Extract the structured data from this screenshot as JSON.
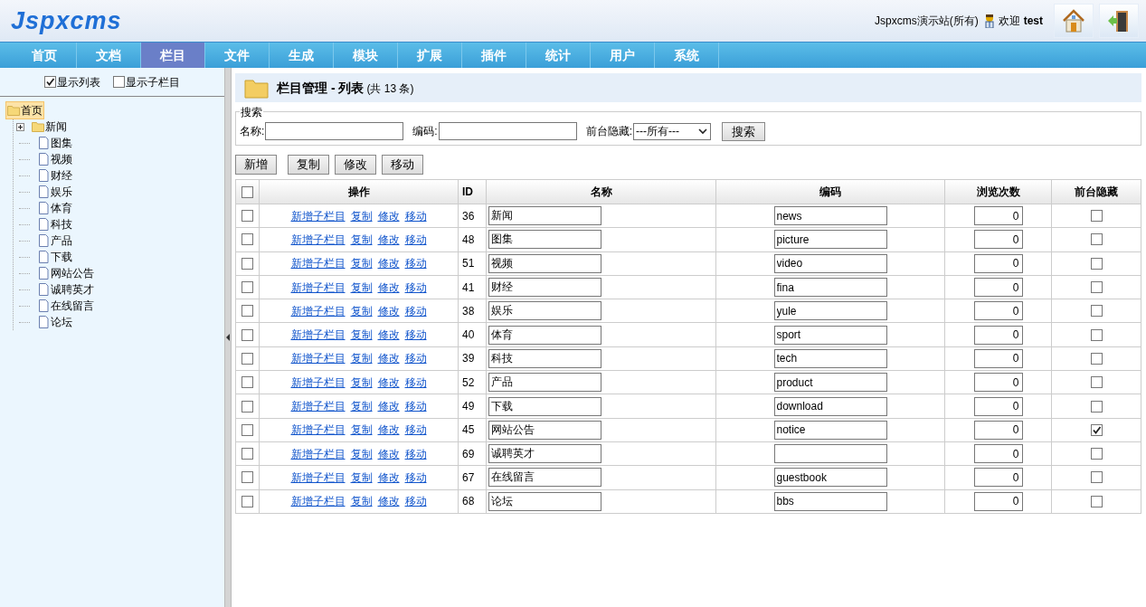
{
  "header": {
    "logo": "Jspxcms",
    "site": "Jspxcms演示站(所有)",
    "welcome": "欢迎",
    "user": "test"
  },
  "nav": [
    {
      "label": "首页",
      "selected": false
    },
    {
      "label": "文档",
      "selected": false
    },
    {
      "label": "栏目",
      "selected": true
    },
    {
      "label": "文件",
      "selected": false
    },
    {
      "label": "生成",
      "selected": false
    },
    {
      "label": "模块",
      "selected": false
    },
    {
      "label": "扩展",
      "selected": false
    },
    {
      "label": "插件",
      "selected": false
    },
    {
      "label": "统计",
      "selected": false
    },
    {
      "label": "用户",
      "selected": false
    },
    {
      "label": "系统",
      "selected": false
    }
  ],
  "sidebar": {
    "options": [
      {
        "label": "显示列表",
        "checked": true
      },
      {
        "label": "显示子栏目",
        "checked": false
      }
    ],
    "tree": [
      {
        "label": "首页",
        "kind": "folder",
        "selected": true,
        "children": [
          {
            "label": "新闻",
            "kind": "folder",
            "selected": false,
            "expanded": false
          },
          {
            "label": "图集",
            "kind": "page",
            "selected": false
          },
          {
            "label": "视频",
            "kind": "page",
            "selected": false
          },
          {
            "label": "财经",
            "kind": "page",
            "selected": false
          },
          {
            "label": "娱乐",
            "kind": "page",
            "selected": false
          },
          {
            "label": "体育",
            "kind": "page",
            "selected": false
          },
          {
            "label": "科技",
            "kind": "page",
            "selected": false
          },
          {
            "label": "产品",
            "kind": "page",
            "selected": false
          },
          {
            "label": "下载",
            "kind": "page",
            "selected": false
          },
          {
            "label": "网站公告",
            "kind": "page",
            "selected": false
          },
          {
            "label": "诚聘英才",
            "kind": "page",
            "selected": false
          },
          {
            "label": "在线留言",
            "kind": "page",
            "selected": false
          },
          {
            "label": "论坛",
            "kind": "page",
            "selected": false
          }
        ]
      }
    ]
  },
  "page": {
    "title": "栏目管理 - 列表",
    "count": "(共 13 条)"
  },
  "search": {
    "legend": "搜索",
    "fields": [
      {
        "label": "名称:",
        "kind": "text"
      },
      {
        "label": "编码:",
        "kind": "text"
      },
      {
        "label": "前台隐藏:",
        "kind": "select",
        "value": "---所有---"
      }
    ],
    "button": "搜索"
  },
  "actions": [
    "新增",
    "复制",
    "修改",
    "移动"
  ],
  "table": {
    "all_checked": false,
    "columns": [
      "操作",
      "ID",
      "名称",
      "编码",
      "浏览次数",
      "前台隐藏"
    ],
    "rows": [
      {
        "checked": false,
        "actions": [
          "新增子栏目",
          "复制",
          "修改",
          "移动"
        ],
        "id": "36",
        "name": "新闻",
        "code": "news",
        "views": "0",
        "hidden": false
      },
      {
        "checked": false,
        "actions": [
          "新增子栏目",
          "复制",
          "修改",
          "移动"
        ],
        "id": "48",
        "name": "图集",
        "code": "picture",
        "views": "0",
        "hidden": false
      },
      {
        "checked": false,
        "actions": [
          "新增子栏目",
          "复制",
          "修改",
          "移动"
        ],
        "id": "51",
        "name": "视频",
        "code": "video",
        "views": "0",
        "hidden": false
      },
      {
        "checked": false,
        "actions": [
          "新增子栏目",
          "复制",
          "修改",
          "移动"
        ],
        "id": "41",
        "name": "财经",
        "code": "fina",
        "views": "0",
        "hidden": false
      },
      {
        "checked": false,
        "actions": [
          "新增子栏目",
          "复制",
          "修改",
          "移动"
        ],
        "id": "38",
        "name": "娱乐",
        "code": "yule",
        "views": "0",
        "hidden": false
      },
      {
        "checked": false,
        "actions": [
          "新增子栏目",
          "复制",
          "修改",
          "移动"
        ],
        "id": "40",
        "name": "体育",
        "code": "sport",
        "views": "0",
        "hidden": false
      },
      {
        "checked": false,
        "actions": [
          "新增子栏目",
          "复制",
          "修改",
          "移动"
        ],
        "id": "39",
        "name": "科技",
        "code": "tech",
        "views": "0",
        "hidden": false
      },
      {
        "checked": false,
        "actions": [
          "新增子栏目",
          "复制",
          "修改",
          "移动"
        ],
        "id": "52",
        "name": "产品",
        "code": "product",
        "views": "0",
        "hidden": false
      },
      {
        "checked": false,
        "actions": [
          "新增子栏目",
          "复制",
          "修改",
          "移动"
        ],
        "id": "49",
        "name": "下载",
        "code": "download",
        "views": "0",
        "hidden": false
      },
      {
        "checked": false,
        "actions": [
          "新增子栏目",
          "复制",
          "修改",
          "移动"
        ],
        "id": "45",
        "name": "网站公告",
        "code": "notice",
        "views": "0",
        "hidden": true
      },
      {
        "checked": false,
        "actions": [
          "新增子栏目",
          "复制",
          "修改",
          "移动"
        ],
        "id": "69",
        "name": "诚聘英才",
        "views": "0",
        "hidden": false
      },
      {
        "checked": false,
        "actions": [
          "新增子栏目",
          "复制",
          "修改",
          "移动"
        ],
        "id": "67",
        "name": "在线留言",
        "code": "guestbook",
        "views": "0",
        "hidden": false
      },
      {
        "checked": false,
        "actions": [
          "新增子栏目",
          "复制",
          "修改",
          "移动"
        ],
        "id": "68",
        "name": "论坛",
        "code": "bbs",
        "views": "0",
        "hidden": false
      }
    ]
  }
}
